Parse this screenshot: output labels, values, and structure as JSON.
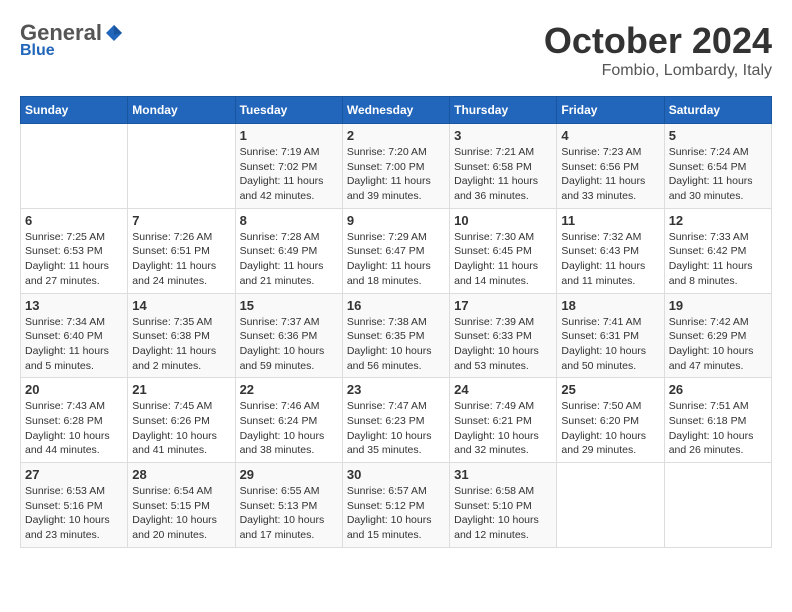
{
  "header": {
    "logo_general": "General",
    "logo_blue": "Blue",
    "month": "October 2024",
    "location": "Fombio, Lombardy, Italy"
  },
  "columns": [
    "Sunday",
    "Monday",
    "Tuesday",
    "Wednesday",
    "Thursday",
    "Friday",
    "Saturday"
  ],
  "weeks": [
    [
      {
        "day": "",
        "sunrise": "",
        "sunset": "",
        "daylight": ""
      },
      {
        "day": "",
        "sunrise": "",
        "sunset": "",
        "daylight": ""
      },
      {
        "day": "1",
        "sunrise": "Sunrise: 7:19 AM",
        "sunset": "Sunset: 7:02 PM",
        "daylight": "Daylight: 11 hours and 42 minutes."
      },
      {
        "day": "2",
        "sunrise": "Sunrise: 7:20 AM",
        "sunset": "Sunset: 7:00 PM",
        "daylight": "Daylight: 11 hours and 39 minutes."
      },
      {
        "day": "3",
        "sunrise": "Sunrise: 7:21 AM",
        "sunset": "Sunset: 6:58 PM",
        "daylight": "Daylight: 11 hours and 36 minutes."
      },
      {
        "day": "4",
        "sunrise": "Sunrise: 7:23 AM",
        "sunset": "Sunset: 6:56 PM",
        "daylight": "Daylight: 11 hours and 33 minutes."
      },
      {
        "day": "5",
        "sunrise": "Sunrise: 7:24 AM",
        "sunset": "Sunset: 6:54 PM",
        "daylight": "Daylight: 11 hours and 30 minutes."
      }
    ],
    [
      {
        "day": "6",
        "sunrise": "Sunrise: 7:25 AM",
        "sunset": "Sunset: 6:53 PM",
        "daylight": "Daylight: 11 hours and 27 minutes."
      },
      {
        "day": "7",
        "sunrise": "Sunrise: 7:26 AM",
        "sunset": "Sunset: 6:51 PM",
        "daylight": "Daylight: 11 hours and 24 minutes."
      },
      {
        "day": "8",
        "sunrise": "Sunrise: 7:28 AM",
        "sunset": "Sunset: 6:49 PM",
        "daylight": "Daylight: 11 hours and 21 minutes."
      },
      {
        "day": "9",
        "sunrise": "Sunrise: 7:29 AM",
        "sunset": "Sunset: 6:47 PM",
        "daylight": "Daylight: 11 hours and 18 minutes."
      },
      {
        "day": "10",
        "sunrise": "Sunrise: 7:30 AM",
        "sunset": "Sunset: 6:45 PM",
        "daylight": "Daylight: 11 hours and 14 minutes."
      },
      {
        "day": "11",
        "sunrise": "Sunrise: 7:32 AM",
        "sunset": "Sunset: 6:43 PM",
        "daylight": "Daylight: 11 hours and 11 minutes."
      },
      {
        "day": "12",
        "sunrise": "Sunrise: 7:33 AM",
        "sunset": "Sunset: 6:42 PM",
        "daylight": "Daylight: 11 hours and 8 minutes."
      }
    ],
    [
      {
        "day": "13",
        "sunrise": "Sunrise: 7:34 AM",
        "sunset": "Sunset: 6:40 PM",
        "daylight": "Daylight: 11 hours and 5 minutes."
      },
      {
        "day": "14",
        "sunrise": "Sunrise: 7:35 AM",
        "sunset": "Sunset: 6:38 PM",
        "daylight": "Daylight: 11 hours and 2 minutes."
      },
      {
        "day": "15",
        "sunrise": "Sunrise: 7:37 AM",
        "sunset": "Sunset: 6:36 PM",
        "daylight": "Daylight: 10 hours and 59 minutes."
      },
      {
        "day": "16",
        "sunrise": "Sunrise: 7:38 AM",
        "sunset": "Sunset: 6:35 PM",
        "daylight": "Daylight: 10 hours and 56 minutes."
      },
      {
        "day": "17",
        "sunrise": "Sunrise: 7:39 AM",
        "sunset": "Sunset: 6:33 PM",
        "daylight": "Daylight: 10 hours and 53 minutes."
      },
      {
        "day": "18",
        "sunrise": "Sunrise: 7:41 AM",
        "sunset": "Sunset: 6:31 PM",
        "daylight": "Daylight: 10 hours and 50 minutes."
      },
      {
        "day": "19",
        "sunrise": "Sunrise: 7:42 AM",
        "sunset": "Sunset: 6:29 PM",
        "daylight": "Daylight: 10 hours and 47 minutes."
      }
    ],
    [
      {
        "day": "20",
        "sunrise": "Sunrise: 7:43 AM",
        "sunset": "Sunset: 6:28 PM",
        "daylight": "Daylight: 10 hours and 44 minutes."
      },
      {
        "day": "21",
        "sunrise": "Sunrise: 7:45 AM",
        "sunset": "Sunset: 6:26 PM",
        "daylight": "Daylight: 10 hours and 41 minutes."
      },
      {
        "day": "22",
        "sunrise": "Sunrise: 7:46 AM",
        "sunset": "Sunset: 6:24 PM",
        "daylight": "Daylight: 10 hours and 38 minutes."
      },
      {
        "day": "23",
        "sunrise": "Sunrise: 7:47 AM",
        "sunset": "Sunset: 6:23 PM",
        "daylight": "Daylight: 10 hours and 35 minutes."
      },
      {
        "day": "24",
        "sunrise": "Sunrise: 7:49 AM",
        "sunset": "Sunset: 6:21 PM",
        "daylight": "Daylight: 10 hours and 32 minutes."
      },
      {
        "day": "25",
        "sunrise": "Sunrise: 7:50 AM",
        "sunset": "Sunset: 6:20 PM",
        "daylight": "Daylight: 10 hours and 29 minutes."
      },
      {
        "day": "26",
        "sunrise": "Sunrise: 7:51 AM",
        "sunset": "Sunset: 6:18 PM",
        "daylight": "Daylight: 10 hours and 26 minutes."
      }
    ],
    [
      {
        "day": "27",
        "sunrise": "Sunrise: 6:53 AM",
        "sunset": "Sunset: 5:16 PM",
        "daylight": "Daylight: 10 hours and 23 minutes."
      },
      {
        "day": "28",
        "sunrise": "Sunrise: 6:54 AM",
        "sunset": "Sunset: 5:15 PM",
        "daylight": "Daylight: 10 hours and 20 minutes."
      },
      {
        "day": "29",
        "sunrise": "Sunrise: 6:55 AM",
        "sunset": "Sunset: 5:13 PM",
        "daylight": "Daylight: 10 hours and 17 minutes."
      },
      {
        "day": "30",
        "sunrise": "Sunrise: 6:57 AM",
        "sunset": "Sunset: 5:12 PM",
        "daylight": "Daylight: 10 hours and 15 minutes."
      },
      {
        "day": "31",
        "sunrise": "Sunrise: 6:58 AM",
        "sunset": "Sunset: 5:10 PM",
        "daylight": "Daylight: 10 hours and 12 minutes."
      },
      {
        "day": "",
        "sunrise": "",
        "sunset": "",
        "daylight": ""
      },
      {
        "day": "",
        "sunrise": "",
        "sunset": "",
        "daylight": ""
      }
    ]
  ]
}
